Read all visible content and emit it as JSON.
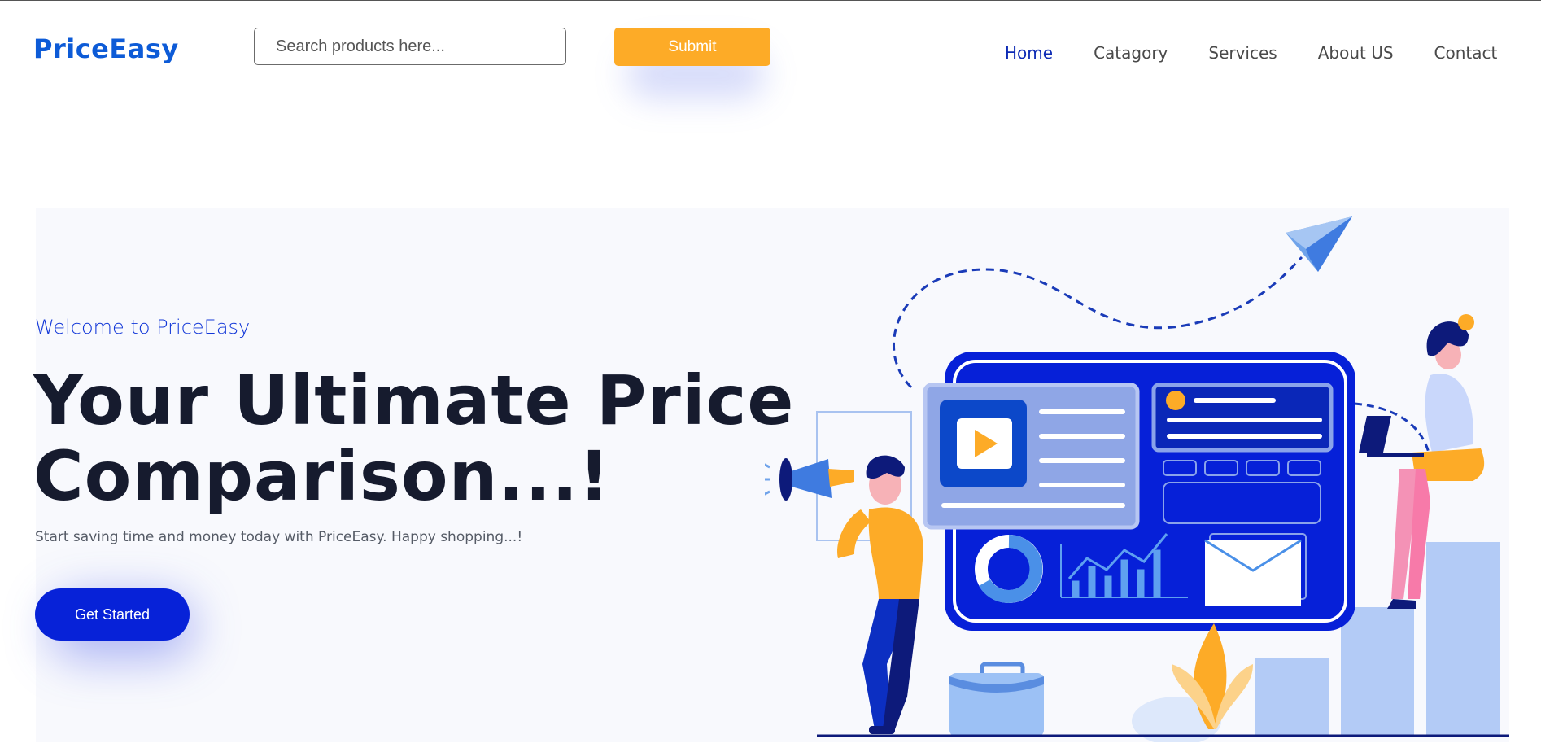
{
  "header": {
    "logo": "PriceEasy",
    "search": {
      "placeholder": "Search products here...",
      "value": ""
    },
    "submit_label": "Submit",
    "nav": [
      {
        "label": "Home",
        "active": true
      },
      {
        "label": "Catagory",
        "active": false
      },
      {
        "label": "Services",
        "active": false
      },
      {
        "label": "About US",
        "active": false
      },
      {
        "label": "Contact",
        "active": false
      }
    ]
  },
  "hero": {
    "welcome": "Welcome to PriceEasy",
    "headline_line1": "Your Ultimate Price",
    "headline_line2": "Comparison...!",
    "subtitle": "Start saving time and money today with PriceEasy. Happy shopping...!",
    "cta_label": "Get Started",
    "illustration": "marketing-dashboard-illustration"
  },
  "colors": {
    "brand_blue": "#0d5bd7",
    "accent_orange": "#fdab27",
    "cta_blue": "#0722d8",
    "nav_active": "#0d2bb5",
    "headline": "#161b2e"
  }
}
